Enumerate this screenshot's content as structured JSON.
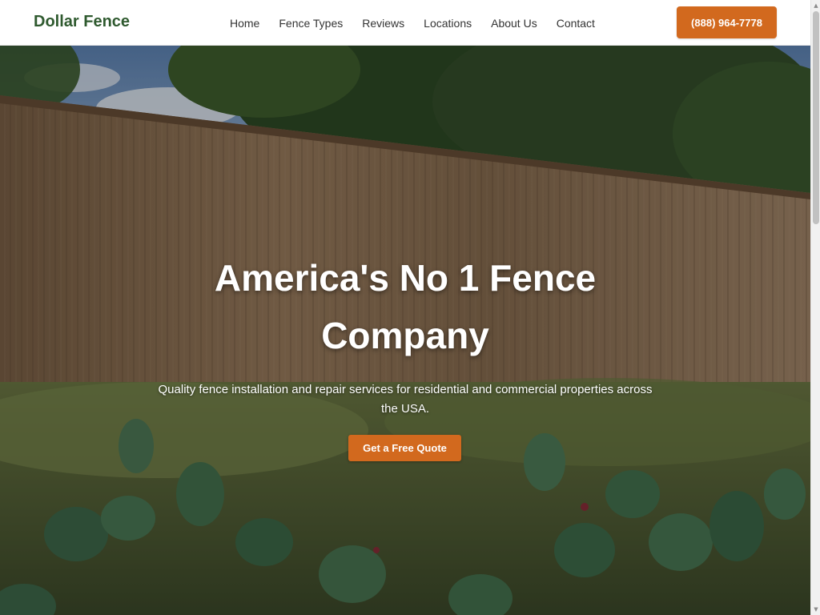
{
  "header": {
    "logo": "Dollar Fence",
    "nav": [
      "Home",
      "Fence Types",
      "Reviews",
      "Locations",
      "About Us",
      "Contact"
    ],
    "phone_label": "(888) 964-7778"
  },
  "hero": {
    "title": "America's No 1 Fence Company",
    "subtitle": "Quality fence installation and repair services for residential and commercial properties across the USA.",
    "cta_label": "Get a Free Quote"
  },
  "colors": {
    "brand_green": "#2f5a2f",
    "accent_orange": "#d2691e"
  },
  "icons": {
    "scroll_up": "arrow-up-icon",
    "scroll_down": "arrow-down-icon"
  }
}
